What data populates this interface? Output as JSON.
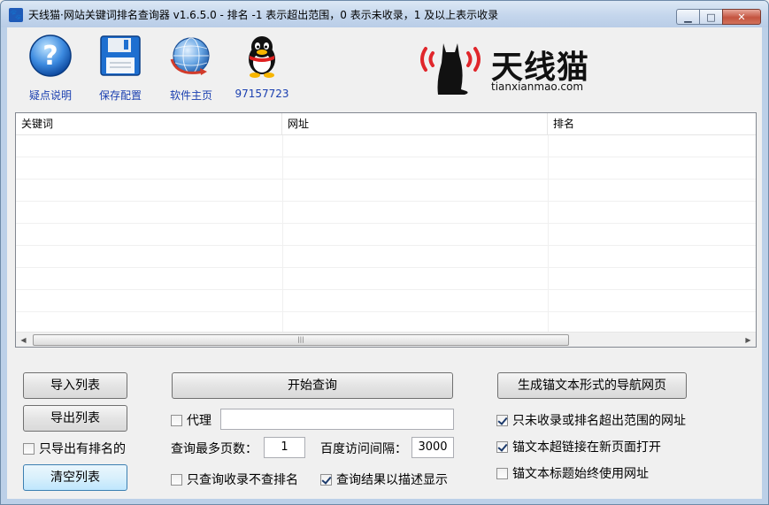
{
  "window": {
    "title": "天线猫·网站关键词排名查询器 v1.6.5.0 - 排名 -1 表示超出范围，0 表示未收录，1 及以上表示收录",
    "controls": {
      "minimize": "▁",
      "maximize": "□",
      "close": "✕"
    }
  },
  "toolbar": {
    "items": [
      {
        "label": "疑点说明",
        "icon": "help-icon"
      },
      {
        "label": "保存配置",
        "icon": "floppy-disk-icon"
      },
      {
        "label": "软件主页",
        "icon": "globe-icon"
      },
      {
        "label": "97157723",
        "icon": "qq-penguin-icon"
      }
    ]
  },
  "logo": {
    "name": "天线猫",
    "domain": "tianxianmao.com"
  },
  "list": {
    "columns": [
      "关键词",
      "网址",
      "排名"
    ],
    "rows": []
  },
  "buttons": {
    "import": "导入列表",
    "export": "导出列表",
    "clear": "清空列表",
    "start": "开始查询",
    "generate": "生成锚文本形式的导航网页"
  },
  "options": {
    "export_ranked_only": {
      "label": "只导出有排名的",
      "checked": false
    },
    "proxy": {
      "label": "代理",
      "checked": false,
      "value": ""
    },
    "max_pages": {
      "label": "查询最多页数：",
      "value": "1"
    },
    "interval": {
      "label": "百度访问间隔：",
      "value": "3000"
    },
    "only_indexed": {
      "label": "只查询收录不查排名",
      "checked": false
    },
    "show_desc": {
      "label": "查询结果以描述显示",
      "checked": true
    },
    "only_unindexed_urls": {
      "label": "只未收录或排名超出范围的网址",
      "checked": true
    },
    "open_new_page": {
      "label": "锚文本超链接在新页面打开",
      "checked": true
    },
    "title_use_url": {
      "label": "锚文本标题始终使用网址",
      "checked": false
    }
  },
  "colors": {
    "link": "#1a3fb0",
    "accent": "#e0262b"
  }
}
